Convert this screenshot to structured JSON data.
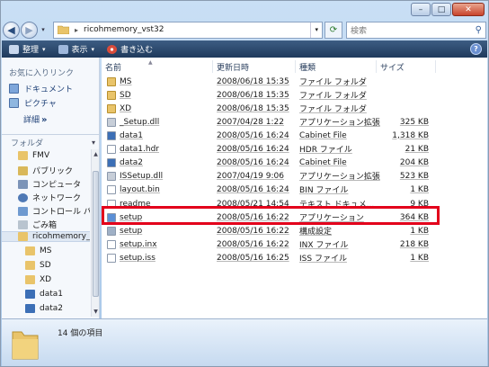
{
  "window": {
    "caption": {
      "minimize": "–",
      "maximize": "□",
      "close": "✕"
    }
  },
  "address": {
    "back": "◀",
    "forward": "▶",
    "dropdown": "▾",
    "separator": "▸",
    "path": "ricohmemory_vst32",
    "refresh": "⟳",
    "search_placeholder": "検索",
    "search_icon": "magnifier-icon"
  },
  "toolbar": {
    "organize": "整理",
    "view": "表示",
    "burn": "書き込む",
    "arrow": "▾",
    "help": "?"
  },
  "navpane": {
    "favorites_title": "お気に入りリンク",
    "favorites": [
      "ドキュメント",
      "ピクチャ"
    ],
    "more": "詳細",
    "more_glyph": "»",
    "folders_title": "フォルダ",
    "folders_chevron": "▾",
    "tree": [
      "FMV",
      "パブリック",
      "コンピュータ",
      "ネットワーク",
      "コントロール パネ",
      "ごみ箱",
      "ricohmemory_vs",
      "MS",
      "SD",
      "XD",
      "data1",
      "data2"
    ],
    "scroll_up": "▲",
    "scroll_down": "▼"
  },
  "list": {
    "headers": {
      "name": "名前",
      "date": "更新日時",
      "type": "種類",
      "size": "サイズ",
      "sort_arrow": "▲"
    },
    "rows": [
      {
        "name": "MS",
        "date": "2008/06/18 15:35",
        "type": "ファイル フォルダ",
        "size": "",
        "icon": "folder"
      },
      {
        "name": "SD",
        "date": "2008/06/18 15:35",
        "type": "ファイル フォルダ",
        "size": "",
        "icon": "folder"
      },
      {
        "name": "XD",
        "date": "2008/06/18 15:35",
        "type": "ファイル フォルダ",
        "size": "",
        "icon": "folder"
      },
      {
        "name": "_Setup.dll",
        "date": "2007/04/28 1:22",
        "type": "アプリケーション拡張",
        "size": "325 KB",
        "icon": "dll"
      },
      {
        "name": "data1",
        "date": "2008/05/16 16:24",
        "type": "Cabinet File",
        "size": "1,318 KB",
        "icon": "cab"
      },
      {
        "name": "data1.hdr",
        "date": "2008/05/16 16:24",
        "type": "HDR ファイル",
        "size": "21 KB",
        "icon": "file"
      },
      {
        "name": "data2",
        "date": "2008/05/16 16:24",
        "type": "Cabinet File",
        "size": "204 KB",
        "icon": "cab"
      },
      {
        "name": "ISSetup.dll",
        "date": "2007/04/19 9:06",
        "type": "アプリケーション拡張",
        "size": "523 KB",
        "icon": "dll"
      },
      {
        "name": "layout.bin",
        "date": "2008/05/16 16:24",
        "type": "BIN ファイル",
        "size": "1 KB",
        "icon": "file"
      },
      {
        "name": "readme",
        "date": "2008/05/21 14:54",
        "type": "テキスト ドキュメ...",
        "size": "9 KB",
        "icon": "file"
      },
      {
        "name": "setup",
        "date": "2008/05/16 16:22",
        "type": "アプリケーション",
        "size": "364 KB",
        "icon": "exe"
      },
      {
        "name": "setup",
        "date": "2008/05/16 16:22",
        "type": "構成設定",
        "size": "1 KB",
        "icon": "ini"
      },
      {
        "name": "setup.inx",
        "date": "2008/05/16 16:22",
        "type": "INX ファイル",
        "size": "218 KB",
        "icon": "file"
      },
      {
        "name": "setup.iss",
        "date": "2008/05/16 16:25",
        "type": "ISS ファイル",
        "size": "1 KB",
        "icon": "file"
      }
    ]
  },
  "status": {
    "count": "14 個の項目"
  },
  "colors": {
    "highlight": "#e3001b",
    "toolbar": "#2a4a70",
    "folder": "#e9c46a",
    "link": "#1d3f76"
  }
}
